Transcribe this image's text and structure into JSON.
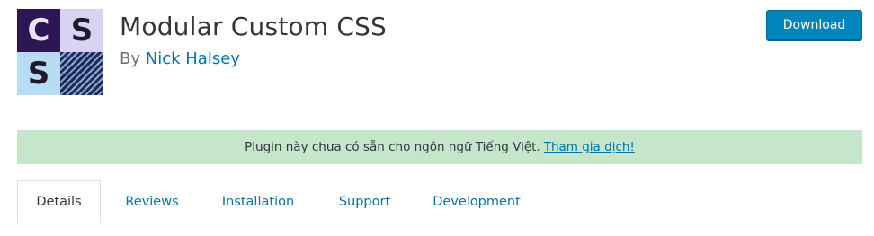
{
  "plugin": {
    "icon_letters": [
      "C",
      "S",
      "S"
    ],
    "title": "Modular Custom CSS",
    "by_label": "By",
    "author": "Nick Halsey"
  },
  "actions": {
    "download_label": "Download"
  },
  "notice": {
    "text": "Plugin này chưa có sẵn cho ngôn ngữ Tiếng Việt.",
    "link": "Tham gia dịch!"
  },
  "tabs": [
    {
      "label": "Details",
      "active": true
    },
    {
      "label": "Reviews",
      "active": false
    },
    {
      "label": "Installation",
      "active": false
    },
    {
      "label": "Support",
      "active": false
    },
    {
      "label": "Development",
      "active": false
    }
  ],
  "colors": {
    "accent": "#0085ba",
    "link": "#0073aa",
    "notice_bg": "#c6e6cb",
    "icon_dark_purple": "#2e1652",
    "icon_light_purple": "#d9d2f3",
    "icon_light_blue": "#b9dcf5",
    "icon_navy": "#1f2a55"
  }
}
